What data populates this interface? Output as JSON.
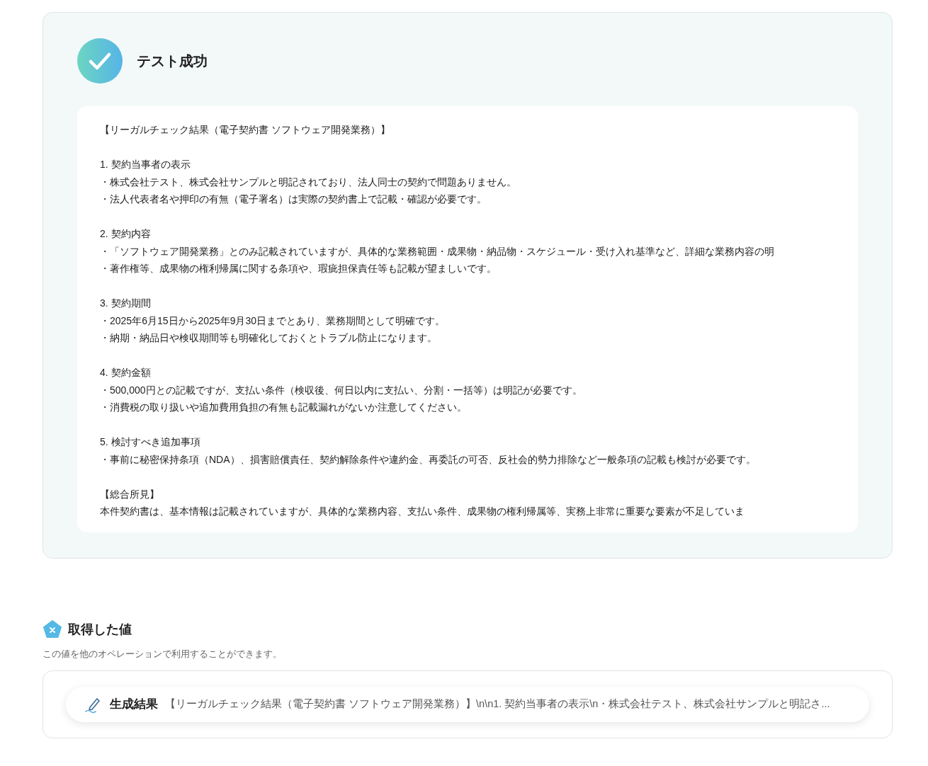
{
  "result_card": {
    "succeeded": true,
    "title": "テスト成功",
    "paragraphs": [
      [
        "【リーガルチェック結果（電子契約書 ソフトウェア開発業務）】"
      ],
      [
        "1. 契約当事者の表示",
        "・株式会社テスト、株式会社サンプルと明記されており、法人同士の契約で問題ありません。",
        "・法人代表者名や押印の有無（電子署名）は実際の契約書上で記載・確認が必要です。"
      ],
      [
        "2. 契約内容",
        "・「ソフトウェア開発業務」とのみ記載されていますが、具体的な業務範囲・成果物・納品物・スケジュール・受け入れ基準など、詳細な業務内容の明",
        "・著作権等、成果物の権利帰属に関する条項や、瑕疵担保責任等も記載が望ましいです。"
      ],
      [
        "3. 契約期間",
        "・2025年6月15日から2025年9月30日までとあり、業務期間として明確です。",
        "・納期・納品日や検収期間等も明確化しておくとトラブル防止になります。"
      ],
      [
        "4. 契約金額",
        "・500,000円との記載ですが、支払い条件（検収後、何日以内に支払い、分割・一括等）は明記が必要です。",
        "・消費税の取り扱いや追加費用負担の有無も記載漏れがないか注意してください。"
      ],
      [
        "5. 検討すべき追加事項",
        "・事前に秘密保持条項（NDA）、損害賠償責任、契約解除条件や違約金、再委託の可否、反社会的勢力排除など一般条項の記載も検討が必要です。"
      ],
      [
        "【総合所見】",
        "本件契約書は、基本情報は記載されていますが、具体的な業務内容、支払い条件、成果物の権利帰属等、実務上非常に重要な要素が不足していま"
      ]
    ]
  },
  "acquired_values": {
    "title": "取得した値",
    "description": "この値を他のオペレーションで利用することができます。",
    "items": [
      {
        "label": "生成結果",
        "value": "【リーガルチェック結果（電子契約書 ソフトウェア開発業務）】\\n\\n1. 契約当事者の表示\\n・株式会社テスト、株式会社サンプルと明記さ..."
      }
    ]
  }
}
